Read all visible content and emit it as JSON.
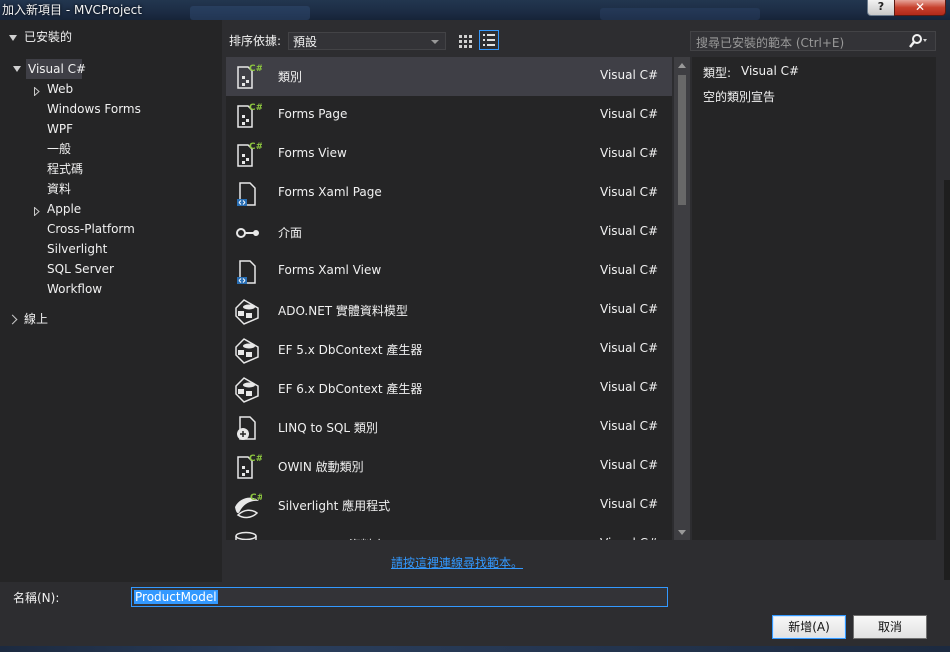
{
  "window": {
    "title": "加入新項目 - MVCProject",
    "help_label": "?",
    "close_label": "✕"
  },
  "tree": {
    "header": "已安裝的",
    "items": [
      {
        "label": "Visual C#",
        "expanded": true,
        "selected": true
      },
      {
        "label": "Web",
        "expandable": true
      },
      {
        "label": "Windows Forms"
      },
      {
        "label": "WPF"
      },
      {
        "label": "一般"
      },
      {
        "label": "程式碼"
      },
      {
        "label": "資料"
      },
      {
        "label": "Apple",
        "expandable": true
      },
      {
        "label": "Cross-Platform"
      },
      {
        "label": "Silverlight"
      },
      {
        "label": "SQL Server"
      },
      {
        "label": "Workflow"
      }
    ],
    "online": "線上"
  },
  "sort": {
    "label": "排序依據:",
    "value": "預設"
  },
  "templates": [
    {
      "name": "類別",
      "lang": "Visual C#",
      "icon": "class-icon",
      "selected": true
    },
    {
      "name": "Forms Page",
      "lang": "Visual C#",
      "icon": "forms-page-icon"
    },
    {
      "name": "Forms View",
      "lang": "Visual C#",
      "icon": "forms-view-icon"
    },
    {
      "name": "Forms Xaml Page",
      "lang": "Visual C#",
      "icon": "xaml-page-icon"
    },
    {
      "name": "介面",
      "lang": "Visual C#",
      "icon": "interface-icon"
    },
    {
      "name": "Forms Xaml View",
      "lang": "Visual C#",
      "icon": "xaml-view-icon"
    },
    {
      "name": "ADO.NET 實體資料模型",
      "lang": "Visual C#",
      "icon": "entity-model-icon"
    },
    {
      "name": "EF 5.x DbContext 產生器",
      "lang": "Visual C#",
      "icon": "ef-generator-icon"
    },
    {
      "name": "EF 6.x DbContext 產生器",
      "lang": "Visual C#",
      "icon": "ef-generator-icon"
    },
    {
      "name": "LINQ to SQL 類別",
      "lang": "Visual C#",
      "icon": "linq-sql-icon"
    },
    {
      "name": "OWIN 啟動類別",
      "lang": "Visual C#",
      "icon": "owin-icon"
    },
    {
      "name": "Silverlight 應用程式",
      "lang": "Visual C#",
      "icon": "silverlight-icon"
    },
    {
      "name": "SQL Server 資料庫",
      "lang": "Visual C#",
      "icon": "database-icon"
    }
  ],
  "online_link": "請按這裡連線尋找範本。",
  "search": {
    "placeholder": "搜尋已安裝的範本 (Ctrl+E)"
  },
  "details": {
    "type_label": "類型:",
    "type_value": "Visual C#",
    "description": "空的類別宣告"
  },
  "name_field": {
    "label": "名稱(N):",
    "value": "ProductModel"
  },
  "buttons": {
    "add": "新增(A)",
    "cancel": "取消"
  },
  "colors": {
    "background": "#2d2d30",
    "panel": "#252526",
    "selection": "#3f3f46",
    "accent": "#3399ff"
  }
}
